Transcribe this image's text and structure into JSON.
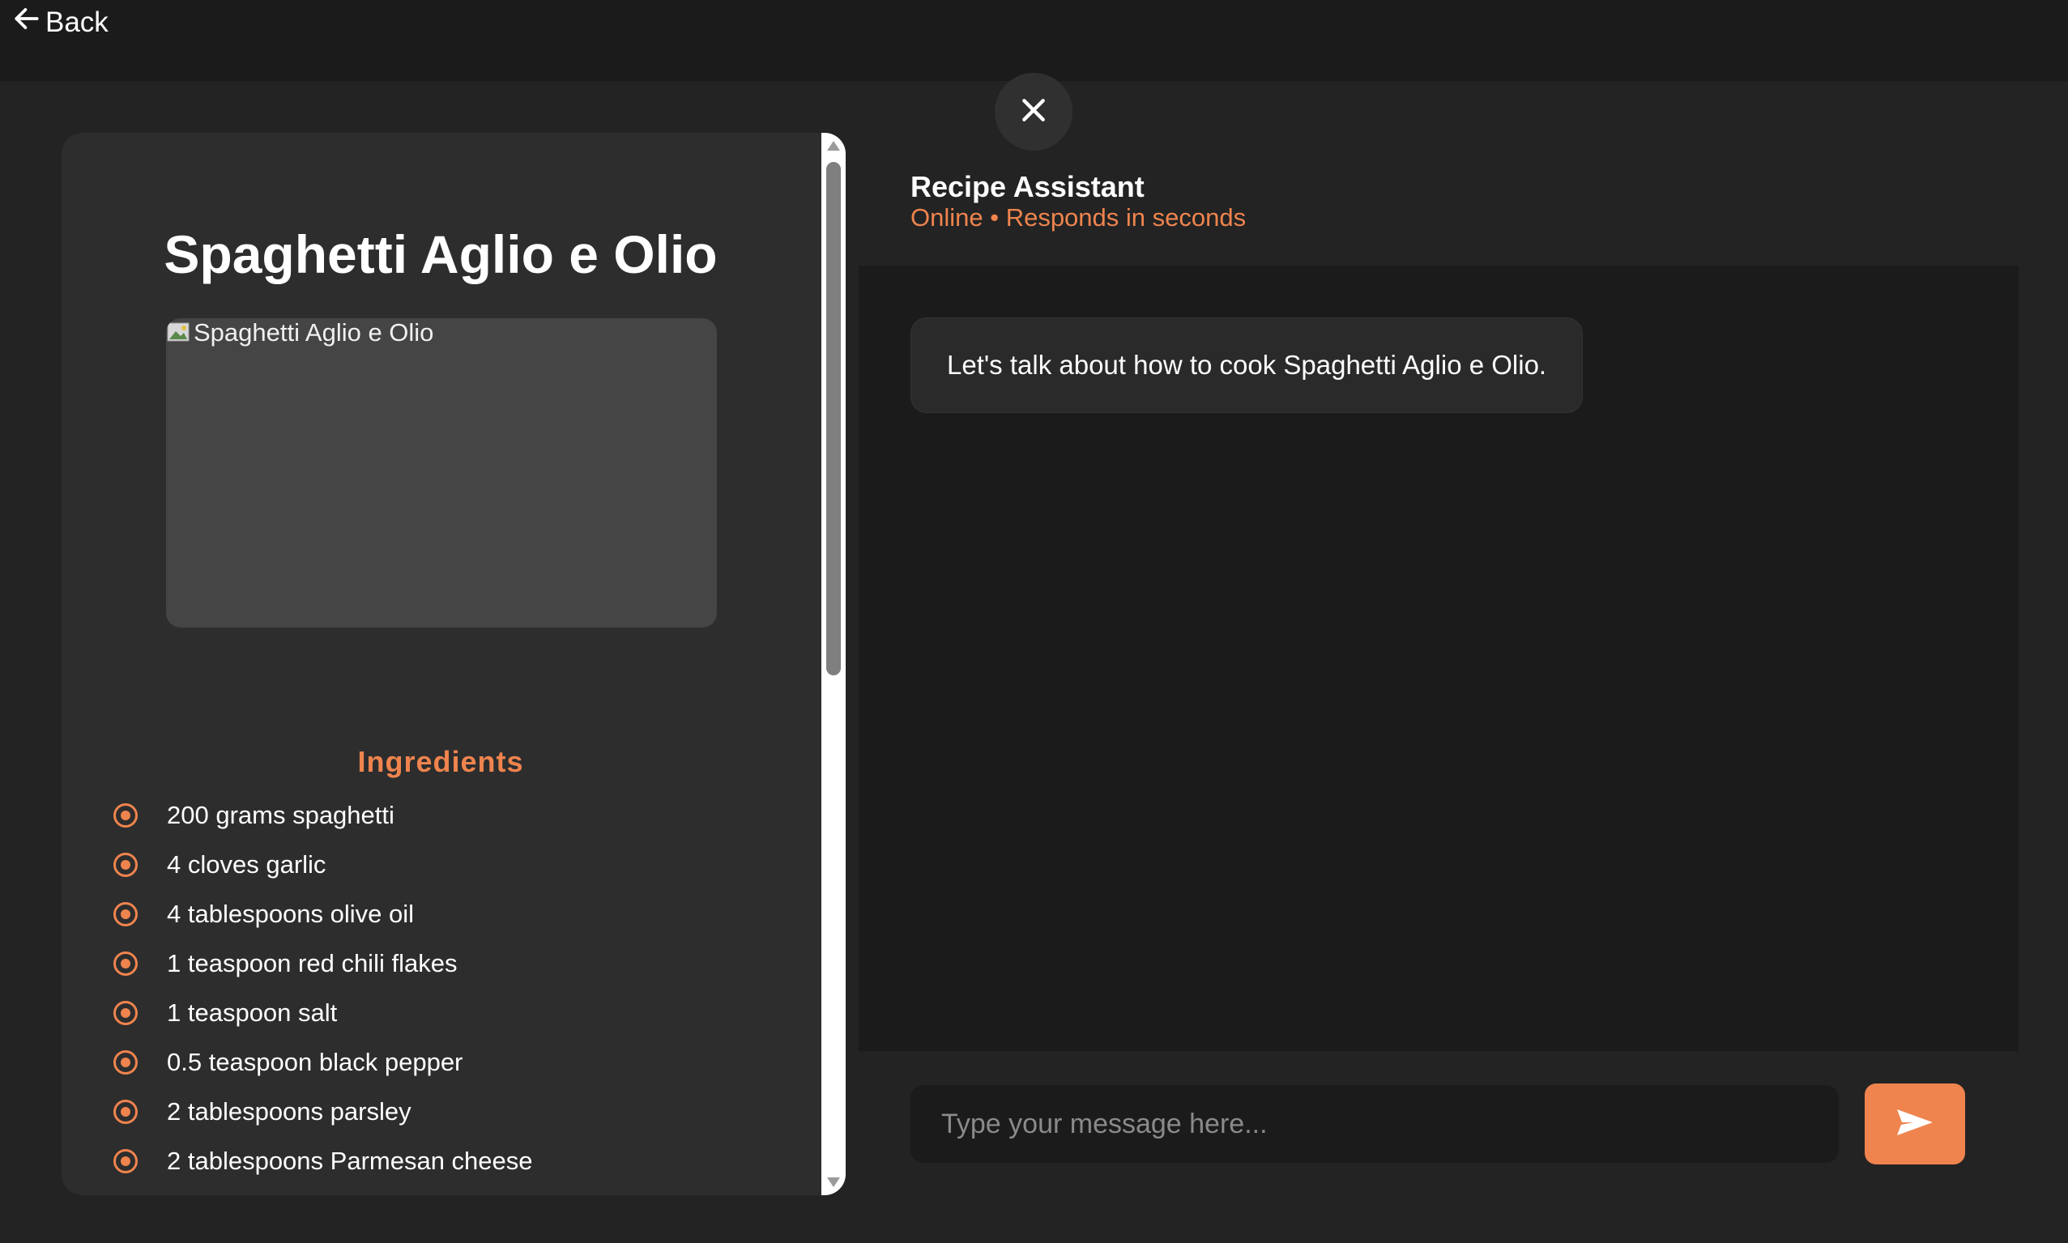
{
  "topbar": {
    "back_label": "Back"
  },
  "recipe": {
    "title": "Spaghetti Aglio e Olio",
    "image_alt": "Spaghetti Aglio e Olio",
    "ingredients_heading": "Ingredients",
    "ingredients": [
      "200 grams spaghetti",
      "4 cloves garlic",
      "4 tablespoons olive oil",
      "1 teaspoon red chili flakes",
      "1 teaspoon salt",
      "0.5 teaspoon black pepper",
      "2 tablespoons parsley",
      "2 tablespoons Parmesan cheese"
    ]
  },
  "chat": {
    "title": "Recipe Assistant",
    "status": "Online • Responds in seconds",
    "messages": [
      {
        "from": "assistant",
        "text": "Let's talk about how to cook Spaghetti Aglio e Olio."
      }
    ],
    "input_placeholder": "Type your message here...",
    "input_value": ""
  },
  "icons": {
    "back": "arrow-left-icon",
    "close": "close-icon",
    "send": "send-icon",
    "bullet": "radio-bullet-icon",
    "broken_image": "broken-image-icon"
  },
  "colors": {
    "accent": "#ef844e",
    "background": "#232323",
    "topbar": "#1b1b1b",
    "card": "#2d2d2d",
    "chat_area": "#1b1b1b",
    "bubble": "#2a2a2a"
  }
}
